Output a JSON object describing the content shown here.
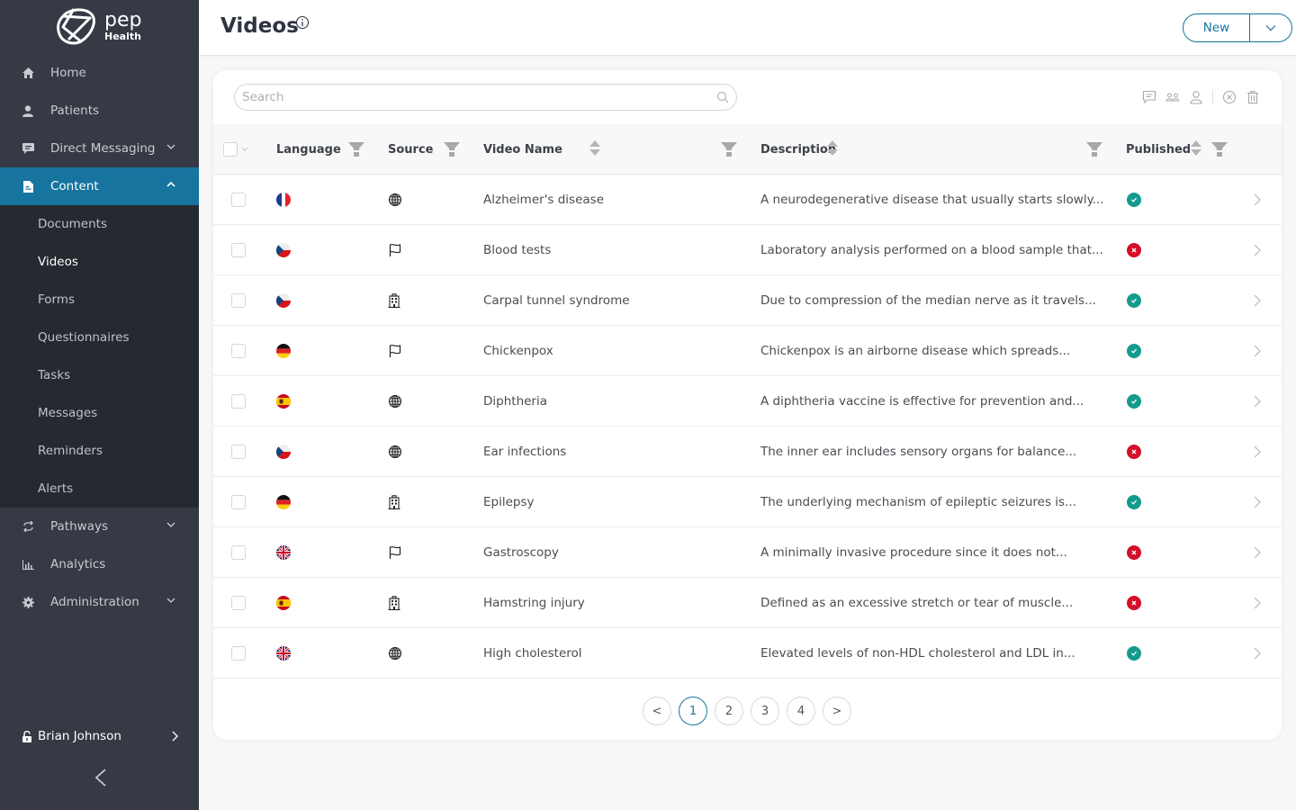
{
  "brand": {
    "name": "pep",
    "sub": "Health"
  },
  "colors": {
    "accent": "#16749f",
    "sidebar": "#353a45",
    "subnav": "#252930",
    "published": "#149b8d",
    "unpublished": "#d40f2a"
  },
  "sidebar": {
    "items": [
      {
        "label": "Home",
        "icon": "home-icon"
      },
      {
        "label": "Patients",
        "icon": "user-icon"
      },
      {
        "label": "Direct Messaging",
        "icon": "chat-icon",
        "expandable": true
      },
      {
        "label": "Content",
        "icon": "document-icon",
        "expandable": true,
        "active": true
      },
      {
        "label": "Pathways",
        "icon": "arrows-cycle-icon",
        "expandable": true
      },
      {
        "label": "Analytics",
        "icon": "bar-chart-icon"
      },
      {
        "label": "Administration",
        "icon": "gear-icon",
        "expandable": true
      }
    ],
    "content_subitems": [
      {
        "label": "Documents"
      },
      {
        "label": "Videos",
        "active": true
      },
      {
        "label": "Forms"
      },
      {
        "label": "Questionnaires"
      },
      {
        "label": "Tasks"
      },
      {
        "label": "Messages"
      },
      {
        "label": "Reminders"
      },
      {
        "label": "Alerts"
      }
    ],
    "user": "Brian Johnson"
  },
  "header": {
    "title": "Videos",
    "new_label": "New"
  },
  "search": {
    "placeholder": "Search",
    "value": ""
  },
  "table": {
    "columns": {
      "language": "Language",
      "source": "Source",
      "name": "Video Name",
      "description": "Description",
      "published": "Published"
    },
    "rows": [
      {
        "language": "fr",
        "source": "globe",
        "name": "Alzheimer's disease",
        "description": "A neurodegenerative disease that usually starts slowly...",
        "published": true
      },
      {
        "language": "cz",
        "source": "flag",
        "name": "Blood tests",
        "description": "Laboratory analysis performed on a blood sample that...",
        "published": false
      },
      {
        "language": "cz",
        "source": "building",
        "name": "Carpal tunnel syndrome",
        "description": "Due to compression of the median nerve as it travels...",
        "published": true
      },
      {
        "language": "de",
        "source": "flag",
        "name": "Chickenpox",
        "description": "Chickenpox is an airborne disease which spreads...",
        "published": true
      },
      {
        "language": "es",
        "source": "globe",
        "name": "Diphtheria",
        "description": "A diphtheria vaccine is effective for prevention and...",
        "published": true
      },
      {
        "language": "cz",
        "source": "globe",
        "name": "Ear infections",
        "description": "The inner ear includes sensory organs for balance...",
        "published": false
      },
      {
        "language": "de",
        "source": "building",
        "name": "Epilepsy",
        "description": "The underlying mechanism of epileptic seizures is...",
        "published": true
      },
      {
        "language": "gb",
        "source": "flag",
        "name": "Gastroscopy",
        "description": " A minimally invasive procedure since it does not...",
        "published": false
      },
      {
        "language": "es",
        "source": "building",
        "name": "Hamstring injury",
        "description": "Defined as an excessive stretch or tear of muscle...",
        "published": false
      },
      {
        "language": "gb",
        "source": "globe",
        "name": "High cholesterol",
        "description": "Elevated levels of non-HDL cholesterol and LDL in...",
        "published": true
      }
    ]
  },
  "pagination": {
    "prev": "<",
    "next": ">",
    "pages": [
      "1",
      "2",
      "3",
      "4"
    ],
    "current": "1"
  }
}
